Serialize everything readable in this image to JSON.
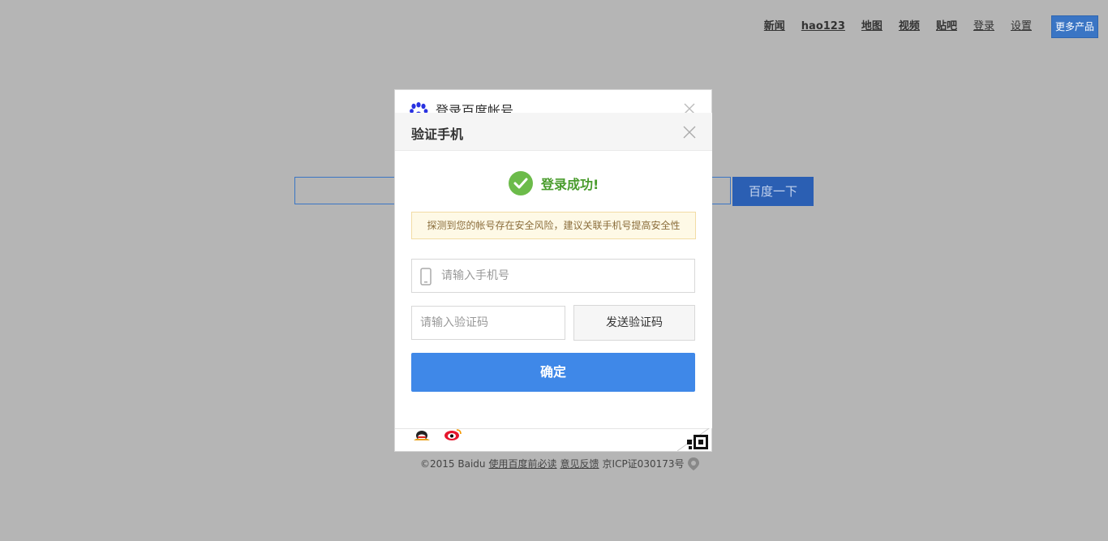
{
  "topnav": {
    "items": [
      "新闻",
      "hao123",
      "地图",
      "视频",
      "贴吧",
      "登录",
      "设置"
    ],
    "more": "更多产品"
  },
  "search": {
    "button": "百度一下"
  },
  "login_dialog": {
    "title": "登录百度帐号"
  },
  "verify_dialog": {
    "title": "验证手机",
    "success": "登录成功!",
    "warning": "探测到您的帐号存在安全风险，建议关联手机号提高安全性",
    "phone_placeholder": "请输入手机号",
    "code_placeholder": "请输入验证码",
    "send_code": "发送验证码",
    "confirm": "确定"
  },
  "footer": {
    "copyright": "©2015 Baidu",
    "terms": "使用百度前必读",
    "feedback": "意见反馈",
    "icp": "京ICP证030173号"
  },
  "colors": {
    "overlay": "#b5b5b5",
    "accent": "#3f88e8",
    "success": "#4a9c2d"
  }
}
